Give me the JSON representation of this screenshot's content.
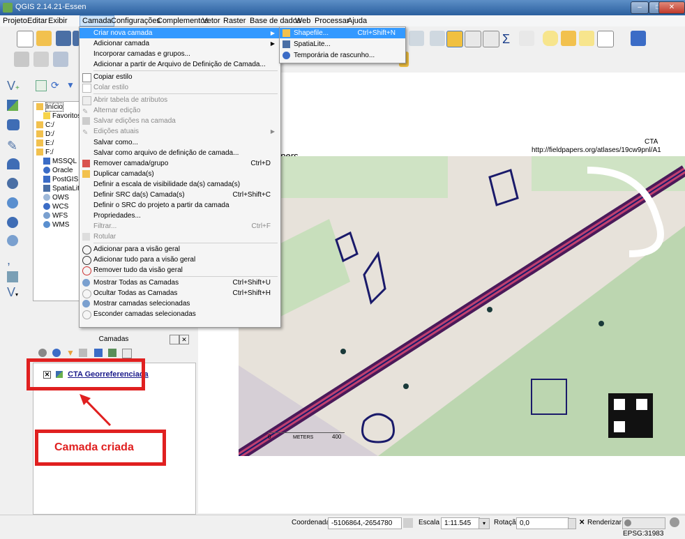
{
  "window": {
    "title": "QGIS 2.14.21-Essen"
  },
  "menubar": {
    "items": [
      "Projeto",
      "Editar",
      "Exibir",
      "Camada",
      "Configurações",
      "Complementos",
      "Vetor",
      "Raster",
      "Base de dados",
      "Web",
      "Processar",
      "Ajuda"
    ]
  },
  "camada_menu": {
    "items": [
      {
        "label": "Criar nova camada",
        "shortcut": "",
        "state": "highlight",
        "submenu": true
      },
      {
        "label": "Adicionar camada",
        "shortcut": "",
        "state": "normal",
        "submenu": true
      },
      {
        "label": "Incorporar camadas e grupos...",
        "shortcut": "",
        "state": "normal"
      },
      {
        "label": "Adicionar a partir de Arquivo de Definição de Camada...",
        "shortcut": "",
        "state": "normal"
      },
      {
        "label": "Copiar estilo",
        "shortcut": "",
        "state": "normal"
      },
      {
        "label": "Colar estilo",
        "shortcut": "",
        "state": "disabled"
      },
      {
        "label": "Abrir tabela de atributos",
        "shortcut": "",
        "state": "disabled"
      },
      {
        "label": "Alternar edição",
        "shortcut": "",
        "state": "disabled"
      },
      {
        "label": "Salvar edições na camada",
        "shortcut": "",
        "state": "disabled"
      },
      {
        "label": "Edições atuais",
        "shortcut": "",
        "state": "disabled",
        "submenu": true
      },
      {
        "label": "Salvar como...",
        "shortcut": "",
        "state": "normal"
      },
      {
        "label": "Salvar como arquivo de definição de camada...",
        "shortcut": "",
        "state": "normal"
      },
      {
        "label": "Remover camada/grupo",
        "shortcut": "Ctrl+D",
        "state": "normal"
      },
      {
        "label": "Duplicar camada(s)",
        "shortcut": "",
        "state": "normal"
      },
      {
        "label": "Definir a escala de visibilidade da(s) camada(s)",
        "shortcut": "",
        "state": "normal"
      },
      {
        "label": "Definir SRC da(s) Camada(s)",
        "shortcut": "Ctrl+Shift+C",
        "state": "normal"
      },
      {
        "label": "Definir o SRC do projeto a partir da camada",
        "shortcut": "",
        "state": "normal"
      },
      {
        "label": "Propriedades...",
        "shortcut": "",
        "state": "normal"
      },
      {
        "label": "Filtrar...",
        "shortcut": "Ctrl+F",
        "state": "disabled"
      },
      {
        "label": "Rotular",
        "shortcut": "",
        "state": "disabled"
      },
      {
        "label": "Adicionar para a visão geral",
        "shortcut": "",
        "state": "normal"
      },
      {
        "label": "Adicionar tudo para a visão geral",
        "shortcut": "",
        "state": "normal"
      },
      {
        "label": "Remover tudo da visão geral",
        "shortcut": "",
        "state": "normal"
      },
      {
        "label": "Mostrar Todas as Camadas",
        "shortcut": "Ctrl+Shift+U",
        "state": "normal"
      },
      {
        "label": "Ocultar Todas as Camadas",
        "shortcut": "Ctrl+Shift+H",
        "state": "normal"
      },
      {
        "label": "Mostrar camadas selecionadas",
        "shortcut": "",
        "state": "normal"
      },
      {
        "label": "Esconder camadas selecionadas",
        "shortcut": "",
        "state": "normal"
      }
    ]
  },
  "submenu": {
    "items": [
      {
        "label": "Shapefile...",
        "shortcut": "Ctrl+Shift+N",
        "state": "highlight"
      },
      {
        "label": "SpatiaLite...",
        "shortcut": "",
        "state": "normal"
      },
      {
        "label": "Temporária de rascunho...",
        "shortcut": "",
        "state": "normal"
      }
    ]
  },
  "browser": {
    "items": [
      "Início",
      "Favoritos",
      "C:/",
      "D:/",
      "E:/",
      "F:/",
      "MSSQL",
      "Oracle",
      "PostGIS",
      "SpatiaLite",
      "OWS",
      "WCS",
      "WFS",
      "WMS"
    ]
  },
  "layers_panel": {
    "title": "Camadas",
    "layers": [
      {
        "name": "CTA Georreferenciada",
        "visible": true
      }
    ]
  },
  "annotation": {
    "label": "Camada criada"
  },
  "map": {
    "header_left": "pers",
    "header_cta": "CTA",
    "header_url": "http://fieldpapers.org/atlases/19cw9pnl/A1",
    "scale_label": "METERS",
    "scale_zero": "0",
    "scale_max": "400"
  },
  "statusbar": {
    "coord_label": "Coordenada",
    "coord_value": "-5106864,-2654780",
    "scale_label": "Escala",
    "scale_value": "1:11.545",
    "rotation_label": "Rotação",
    "rotation_value": "0,0",
    "render_label": "Renderizar",
    "epsg": "EPSG:31983"
  }
}
